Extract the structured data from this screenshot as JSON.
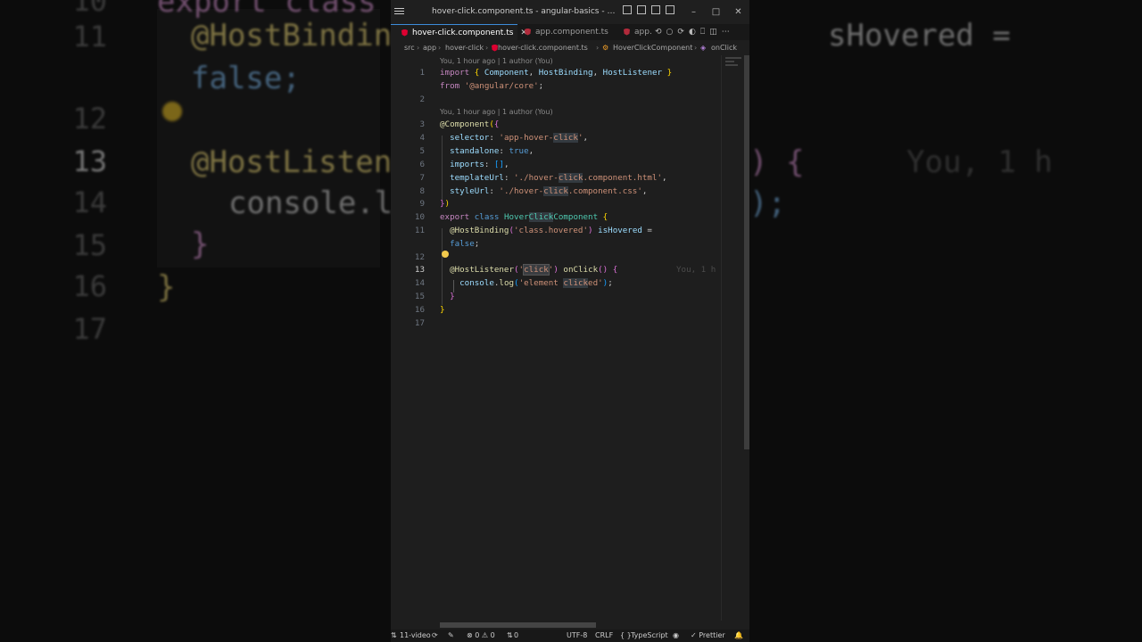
{
  "window": {
    "title": "hover-click.component.ts - angular-basics - Visual Studi..."
  },
  "tabs": [
    {
      "label": "hover-click.component.ts",
      "active": true
    },
    {
      "label": "app.component.ts",
      "active": false
    },
    {
      "label": "app.",
      "active": false
    }
  ],
  "breadcrumb": [
    "src",
    "app",
    "hover-click",
    "hover-click.component.ts",
    "HoverClickComponent",
    "onClick"
  ],
  "codelens": {
    "top": "You, 1 hour ago | 1 author (You)",
    "mid": "You, 1 hour ago | 1 author (You)"
  },
  "line_numbers": [
    "1",
    "2",
    "3",
    "4",
    "5",
    "6",
    "7",
    "8",
    "9",
    "10",
    "11",
    "12",
    "13",
    "14",
    "15",
    "16",
    "17"
  ],
  "inline_blame": "You, 1 h",
  "status": {
    "branch": "11-video",
    "problems": "⊗ 0 ⚠ 0",
    "ports": "0",
    "encoding": "UTF-8",
    "eol": "CRLF",
    "language_braces": "{ }",
    "language": "TypeScript",
    "formatter": "✓ Prettier"
  },
  "background": {
    "nums": [
      "10",
      "11",
      "12",
      "13",
      "14",
      "15",
      "16",
      "17"
    ],
    "line11": "@HostBindin",
    "line11b": "false;",
    "line13": "@HostListene",
    "line14": "console.lo",
    "line15": "}",
    "line16": "}",
    "right11": "sHovered =",
    "right13": ") {",
    "right13b": "You, 1 h",
    "right14": ");",
    "top_frag": "export class"
  },
  "colors": {
    "accent": "#3c8bd9",
    "angular": "#dd0031",
    "editor_bg": "#1e1e1e"
  }
}
